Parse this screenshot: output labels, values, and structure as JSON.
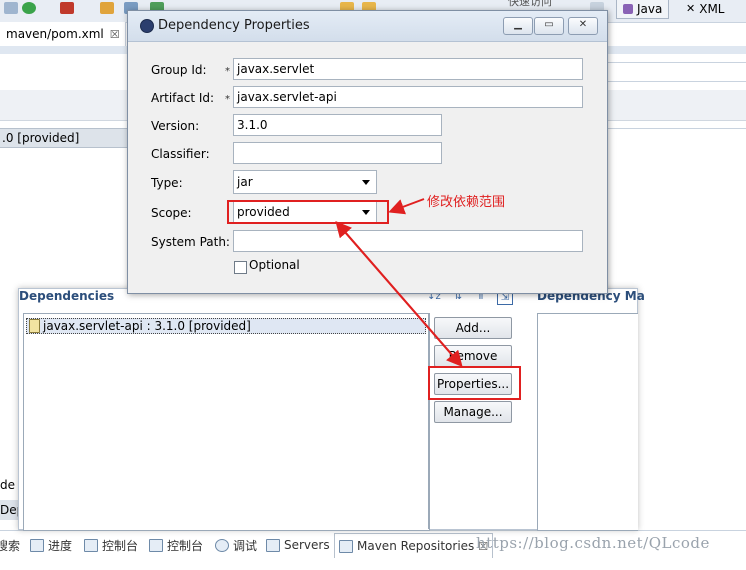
{
  "background": {
    "perspectives": [
      "Java",
      "XML"
    ],
    "toolbar_partial_text": "快速访问",
    "editor_tab": {
      "label": "maven/pom.xml",
      "close": "☒"
    },
    "crumb_text": ".0 [provided]",
    "bottom_left_1": "de",
    "bottom_left_2": "Dep",
    "view_tabs": [
      {
        "label": "搜索"
      },
      {
        "label": "进度"
      },
      {
        "label": "控制台"
      },
      {
        "label": "控制台"
      },
      {
        "label": "调试"
      },
      {
        "label": "Servers"
      },
      {
        "label": "Maven Repositories"
      }
    ],
    "view_tab_close": "☒",
    "watermark": "https://blog.csdn.net/QLcode"
  },
  "dialog": {
    "title": "Dependency Properties",
    "fields": {
      "group_id": {
        "label": "Group Id:",
        "value": "javax.servlet",
        "required": "*"
      },
      "artifact_id": {
        "label": "Artifact Id:",
        "value": "javax.servlet-api",
        "required": "*"
      },
      "version": {
        "label": "Version:",
        "value": "3.1.0"
      },
      "classifier": {
        "label": "Classifier:",
        "value": ""
      },
      "type": {
        "label": "Type:",
        "value": "jar"
      },
      "scope": {
        "label": "Scope:",
        "value": "provided"
      },
      "system_path": {
        "label": "System Path:",
        "value": ""
      },
      "optional": {
        "label": "Optional",
        "checked": false
      }
    }
  },
  "dependencies": {
    "title": "Dependencies",
    "management_title": "Dependency Ma",
    "items": [
      "javax.servlet-api : 3.1.0 [provided]"
    ],
    "buttons": {
      "add": "Add...",
      "remove": "Remove",
      "properties": "Properties...",
      "manage": "Manage..."
    }
  },
  "annotation": {
    "text": "修改依赖范围",
    "color": "#e02020"
  }
}
